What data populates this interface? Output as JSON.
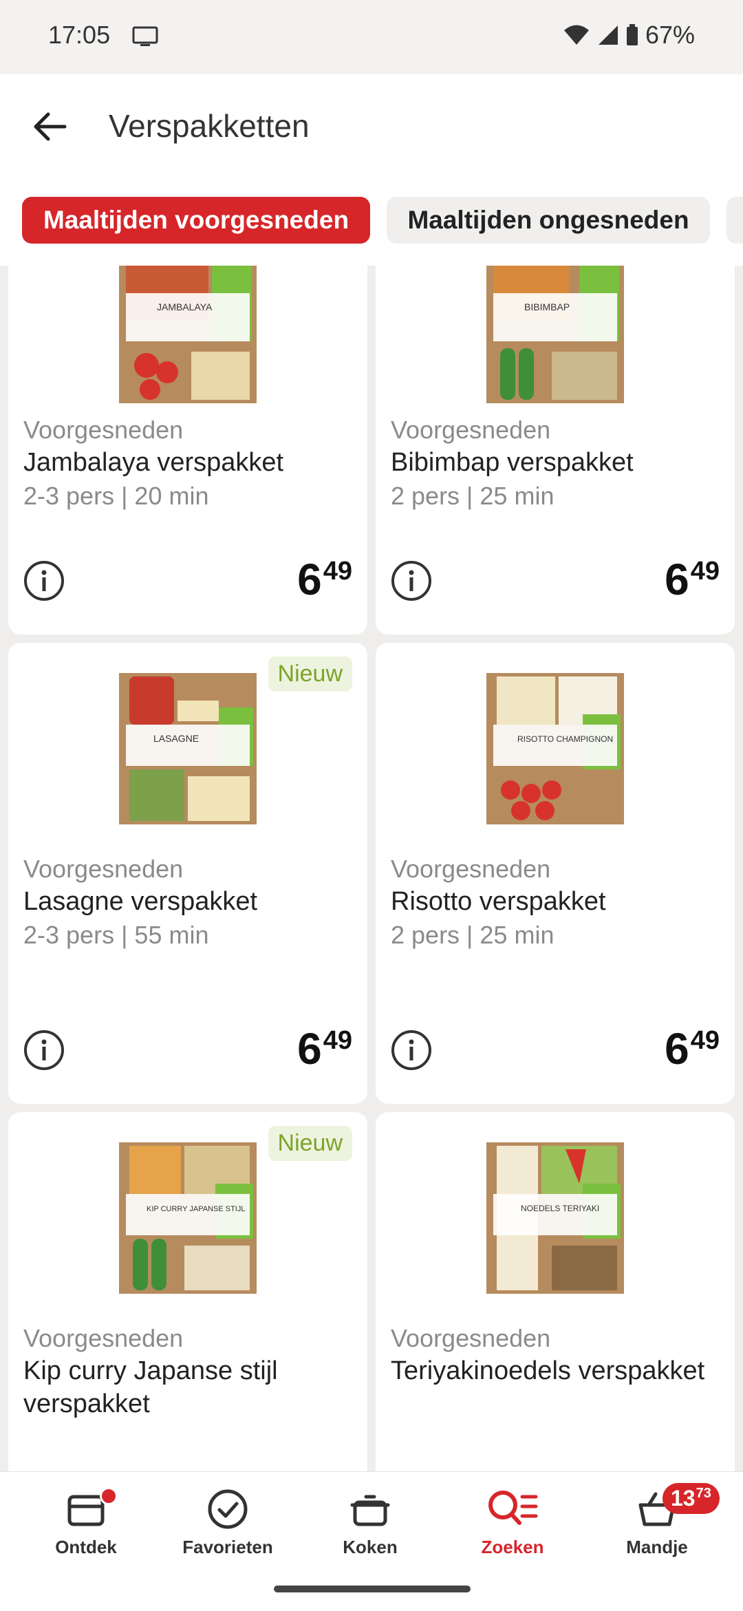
{
  "status": {
    "time": "17:05",
    "battery": "67%"
  },
  "header": {
    "title": "Verspakketten"
  },
  "chips": [
    {
      "label": "Maaltijden voorgesneden"
    },
    {
      "label": "Maaltijden ongesneden"
    }
  ],
  "products": [
    {
      "category": "Voorgesneden",
      "name": "Jambalaya verspakket",
      "meta": "2-3 pers | 20 min",
      "price_int": "6",
      "price_dec": "49",
      "badge": "",
      "box_label": "JAMBALAYA",
      "accent": "#d94a2b"
    },
    {
      "category": "Voorgesneden",
      "name": "Bibimbap verspakket",
      "meta": "2 pers | 25 min",
      "price_int": "6",
      "price_dec": "49",
      "badge": "",
      "box_label": "BIBIMBAP",
      "accent": "#3f8f3a"
    },
    {
      "category": "Voorgesneden",
      "name": "Lasagne verspakket",
      "meta": "2-3 pers | 55 min",
      "price_int": "6",
      "price_dec": "49",
      "badge": "Nieuw",
      "box_label": "LASAGNE",
      "accent": "#c73a2c"
    },
    {
      "category": "Voorgesneden",
      "name": "Risotto verspakket",
      "meta": "2 pers | 25 min",
      "price_int": "6",
      "price_dec": "49",
      "badge": "",
      "box_label": "RISOTTO CHAMPIGNON",
      "accent": "#d7332b"
    },
    {
      "category": "Voorgesneden",
      "name": "Kip curry Japanse stijl verspakket",
      "meta": "",
      "price_int": "",
      "price_dec": "",
      "badge": "Nieuw",
      "box_label": "KIP CURRY JAPANSE STIJL",
      "accent": "#4a8a2e"
    },
    {
      "category": "Voorgesneden",
      "name": "Teriyakinoedels verspakket",
      "meta": "",
      "price_int": "",
      "price_dec": "",
      "badge": "",
      "box_label": "NOEDELS TERIYAKI",
      "accent": "#c9342a"
    }
  ],
  "nav": [
    {
      "label": "Ontdek"
    },
    {
      "label": "Favorieten"
    },
    {
      "label": "Koken"
    },
    {
      "label": "Zoeken"
    },
    {
      "label": "Mandje"
    }
  ],
  "cart": {
    "amount_int": "13",
    "amount_dec": "73"
  },
  "colors": {
    "primary": "#d6262a",
    "box": "#b68b5e",
    "label_green": "#7bbf3f"
  }
}
